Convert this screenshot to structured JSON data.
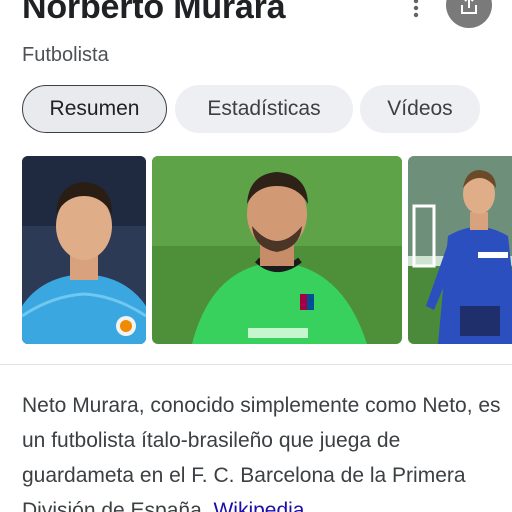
{
  "header": {
    "title": "Norberto Murara",
    "subtitle": "Futbolista",
    "more_icon": "more-vert-icon",
    "share_icon": "share-icon"
  },
  "tabs": [
    {
      "label": "Resumen",
      "active": true
    },
    {
      "label": "Estadísticas",
      "active": false
    },
    {
      "label": "Vídeos",
      "active": false
    }
  ],
  "photos": [
    {
      "description": "Valencia kit portrait"
    },
    {
      "description": "Barcelona goalkeeper kit"
    },
    {
      "description": "Valencia training kit"
    }
  ],
  "description": {
    "text": "Neto Murara, conocido simplemente como Neto, es un futbolista ítalo-brasileño que juega de guardameta en el F. C. Barcelona de la Primera División de España.",
    "source_link": "Wikipedia"
  },
  "colors": {
    "link": "#1a0dab",
    "chip_bg": "#edeff3"
  }
}
